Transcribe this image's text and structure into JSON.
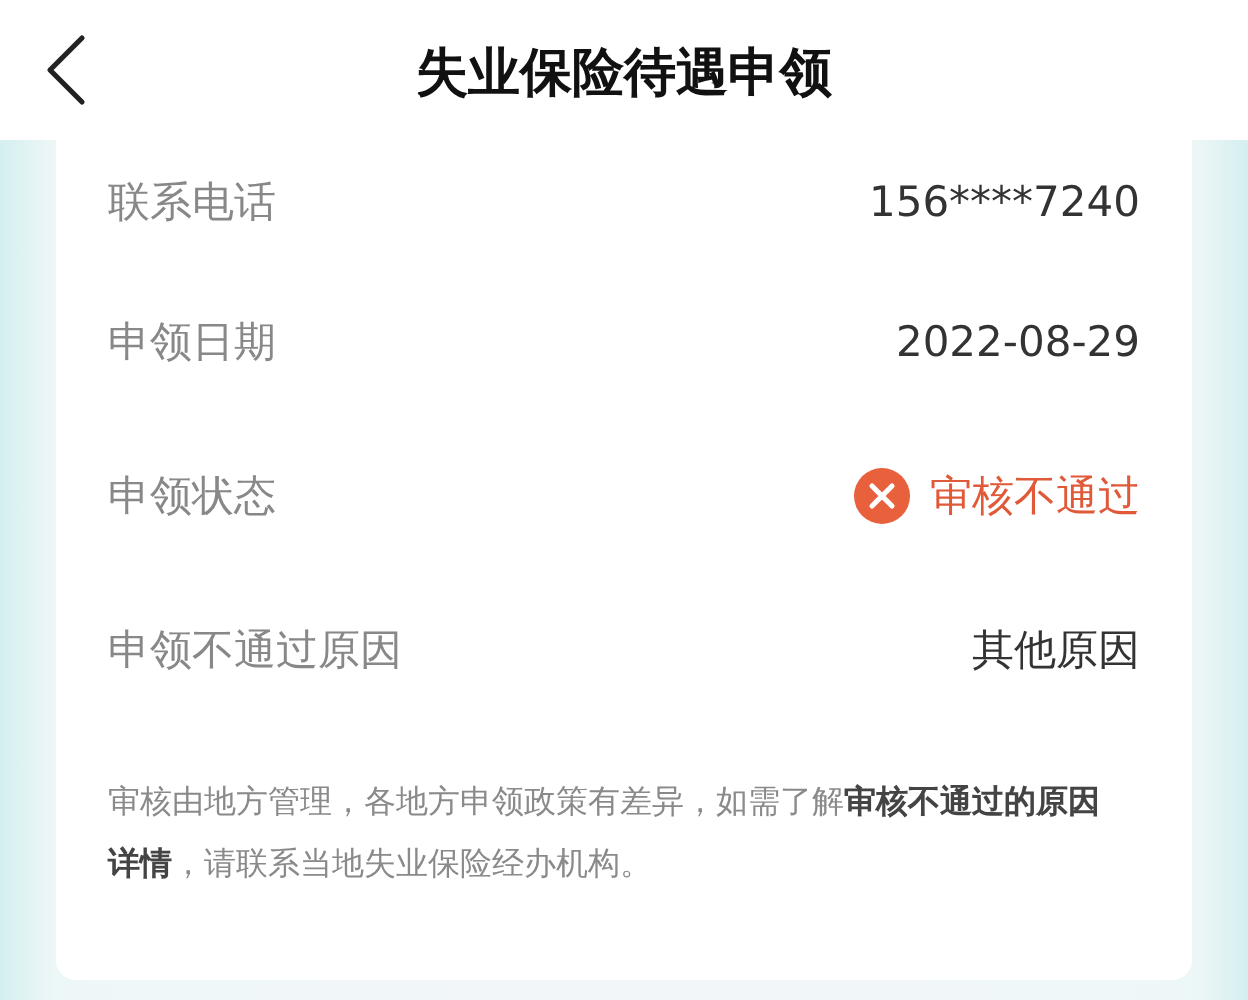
{
  "header": {
    "title": "失业保险待遇申领"
  },
  "rows": [
    {
      "label": "联系电话",
      "kind": "text",
      "value": "156****7240"
    },
    {
      "label": "申领日期",
      "kind": "text",
      "value": "2022-08-29"
    },
    {
      "label": "申领状态",
      "kind": "status",
      "passed": false,
      "value": "审核不通过"
    },
    {
      "label": "申领不通过原因",
      "kind": "text",
      "value": "其他原因"
    }
  ],
  "note": "审核由地方管理，各地方申领政策有差异，如需了解**审核不通过的原因详情**，请联系当地失业保险经办机构。"
}
